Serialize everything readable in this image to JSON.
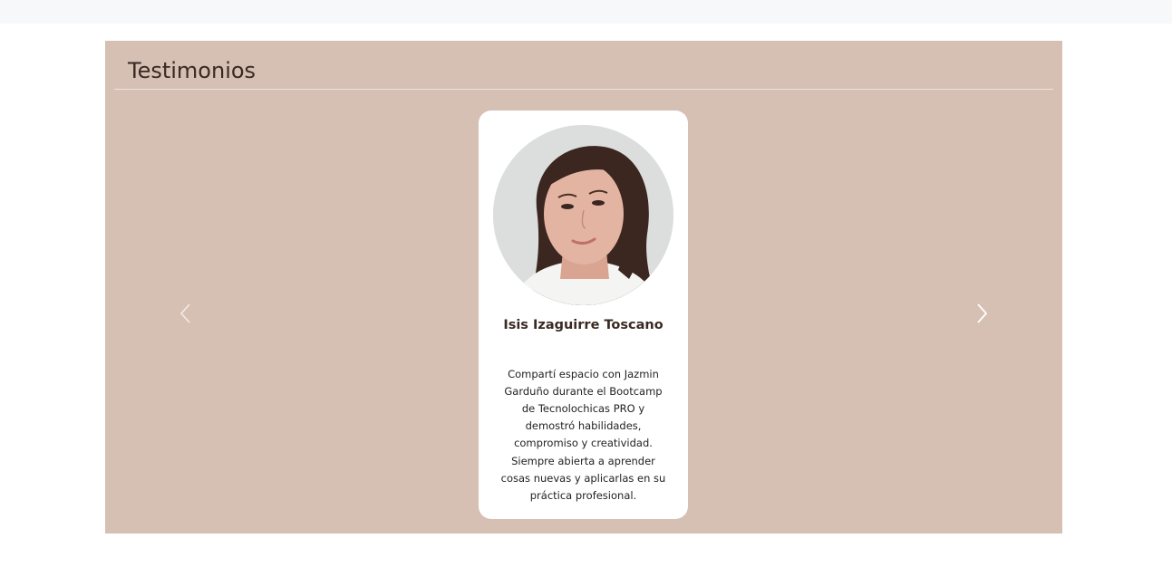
{
  "section": {
    "title": "Testimonios"
  },
  "carousel": {
    "prev_icon": "chevron-left-icon",
    "next_icon": "chevron-right-icon"
  },
  "testimonial": {
    "name": "Isis Izaguirre Toscano",
    "quote": "Compartí espacio con Jazmin Garduño durante el Bootcamp de Tecnolochicas PRO y demostró habilidades, compromiso y creatividad. Siempre abierta a aprender cosas nuevas y aplicarlas en su práctica profesional."
  },
  "colors": {
    "section_background": "#d6c0b4",
    "heading_text": "#3a2a24",
    "card_background": "#ffffff"
  }
}
